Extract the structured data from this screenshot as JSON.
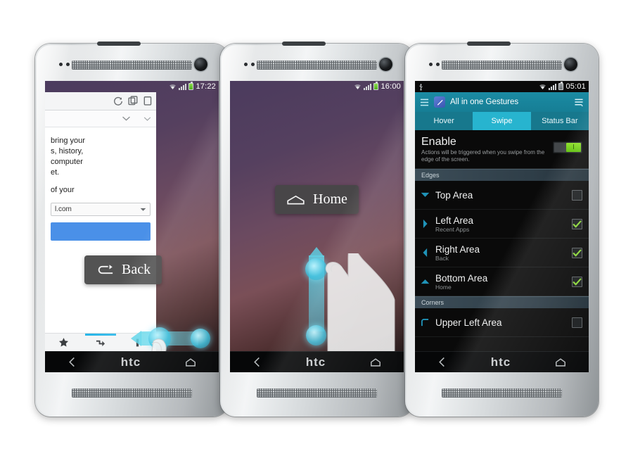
{
  "phones": {
    "left": {
      "status_bar": {
        "time": "17:22",
        "icons": [
          "wifi-icon",
          "signal-icon",
          "battery-icon"
        ]
      },
      "browser": {
        "toolbar_icons": [
          "reload-icon",
          "tabs-icon",
          "new-tab-icon"
        ],
        "row2_icons": [
          "chevron-down-icon",
          "chevron-down-icon"
        ],
        "paragraphs": [
          "bring your\ns, history,\ncomputer\net.",
          "of your"
        ],
        "select_value": "l.com",
        "bottom_icons": [
          "bookmark-star-icon",
          "sync-history-icon",
          "tab-icon"
        ]
      },
      "tooltip": {
        "label": "Back",
        "icon": "back-arrow-icon"
      },
      "swipe": {
        "direction": "horizontal-left",
        "hand": "hand-pointer"
      },
      "nav": {
        "back": "back-icon",
        "brand": "htc",
        "home": "home-icon"
      }
    },
    "middle": {
      "status_bar": {
        "time": "16:00",
        "icons": [
          "wifi-icon",
          "signal-icon",
          "battery-icon"
        ]
      },
      "tooltip": {
        "label": "Home",
        "icon": "home-icon"
      },
      "swipe": {
        "direction": "vertical-up",
        "hand": "hand-pointer"
      },
      "nav": {
        "back": "back-icon",
        "brand": "htc",
        "home": "home-icon"
      }
    },
    "right": {
      "status_bar": {
        "time": "05:01",
        "left_icons": [
          "usb-icon"
        ],
        "icons": [
          "wifi-icon",
          "signal-icon",
          "battery-icon"
        ]
      },
      "app": {
        "menu_icon": "hamburger-icon",
        "app_icon": "gesture-app-icon",
        "title": "All in one Gestures",
        "overflow_icon": "overflow-menu-icon",
        "tabs": [
          {
            "label": "Hover",
            "active": false
          },
          {
            "label": "Swipe",
            "active": true
          },
          {
            "label": "Status Bar",
            "active": false
          }
        ],
        "enable": {
          "title": "Enable",
          "subtitle": "Actions will be triggered when you swipe from the edge of the screen.",
          "toggle_on": true,
          "toggle_glyph": "I"
        },
        "sections": [
          {
            "header": "Edges",
            "items": [
              {
                "title": "Top Area",
                "subtitle": "",
                "icon": "chevron-down-icon",
                "checked": false
              },
              {
                "title": "Left Area",
                "subtitle": "Recent Apps",
                "icon": "chevron-right-icon",
                "checked": true
              },
              {
                "title": "Right Area",
                "subtitle": "Back",
                "icon": "chevron-left-icon",
                "checked": true
              },
              {
                "title": "Bottom Area",
                "subtitle": "Home",
                "icon": "chevron-up-icon",
                "checked": true
              }
            ]
          },
          {
            "header": "Corners",
            "items": [
              {
                "title": "Upper Left Area",
                "subtitle": "",
                "icon": "corner-upper-left-icon",
                "checked": false
              }
            ]
          }
        ]
      },
      "nav": {
        "back": "back-icon",
        "brand": "htc",
        "home": "home-icon"
      }
    }
  },
  "colors": {
    "accent_cyan": "#27b4cf",
    "header_teal": "#167e95",
    "toggle_green": "#76d319",
    "check_green": "#8cd839",
    "swipe_cyan": "#5fd2e8",
    "link_blue": "#4a90e8",
    "background": "#ffffff"
  }
}
